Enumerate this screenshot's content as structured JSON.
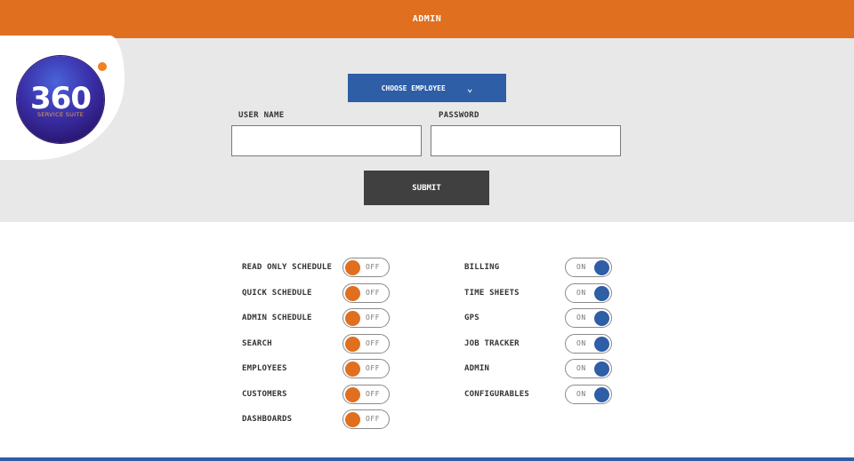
{
  "header": {
    "title": "ADMIN"
  },
  "logo": {
    "number": "360",
    "subtitle": "SERVICE SUITE"
  },
  "form": {
    "choose_employee_label": "CHOOSE EMPLOYEE",
    "username_label": "USER NAME",
    "password_label": "PASSWORD",
    "username_value": "",
    "password_value": "",
    "submit_label": "SUBMIT"
  },
  "colors": {
    "accent_orange": "#e06f1f",
    "accent_blue": "#2e5ea6",
    "panel_gray": "#e8e8e9",
    "button_dark": "#404040"
  },
  "permissions": {
    "left": [
      {
        "label": "READ ONLY SCHEDULE",
        "state": "OFF"
      },
      {
        "label": "QUICK SCHEDULE",
        "state": "OFF"
      },
      {
        "label": "ADMIN SCHEDULE",
        "state": "OFF"
      },
      {
        "label": "SEARCH",
        "state": "OFF"
      },
      {
        "label": "EMPLOYEES",
        "state": "OFF"
      },
      {
        "label": "CUSTOMERS",
        "state": "OFF"
      },
      {
        "label": "DASHBOARDS",
        "state": "OFF"
      }
    ],
    "right": [
      {
        "label": "BILLING",
        "state": "ON"
      },
      {
        "label": "TIME SHEETS",
        "state": "ON"
      },
      {
        "label": "GPS",
        "state": "ON"
      },
      {
        "label": "JOB TRACKER",
        "state": "ON"
      },
      {
        "label": "ADMIN",
        "state": "ON"
      },
      {
        "label": "CONFIGURABLES",
        "state": "ON"
      }
    ]
  }
}
